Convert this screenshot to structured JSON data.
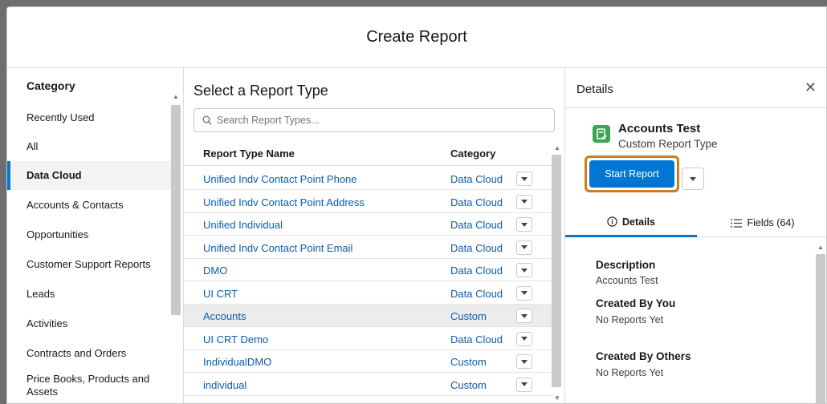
{
  "modal": {
    "title": "Create Report"
  },
  "category": {
    "title": "Category",
    "items": [
      {
        "label": "Recently Used"
      },
      {
        "label": "All"
      },
      {
        "label": "Data Cloud"
      },
      {
        "label": "Accounts & Contacts"
      },
      {
        "label": "Opportunities"
      },
      {
        "label": "Customer Support Reports"
      },
      {
        "label": "Leads"
      },
      {
        "label": "Activities"
      },
      {
        "label": "Contracts and Orders"
      },
      {
        "label": "Price Books, Products and Assets"
      }
    ],
    "selected": "Data Cloud"
  },
  "report_types": {
    "title": "Select a Report Type",
    "search_placeholder": "Search Report Types...",
    "columns": {
      "name": "Report Type Name",
      "category": "Category"
    },
    "rows": [
      {
        "name": "Unified Indv Contact Point Phone",
        "category": "Data Cloud"
      },
      {
        "name": "Unified Indv Contact Point Address",
        "category": "Data Cloud"
      },
      {
        "name": "Unified Individual",
        "category": "Data Cloud"
      },
      {
        "name": "Unified Indv Contact Point Email",
        "category": "Data Cloud"
      },
      {
        "name": "DMO",
        "category": "Data Cloud"
      },
      {
        "name": "UI CRT",
        "category": "Data Cloud"
      },
      {
        "name": "Accounts",
        "category": "Custom"
      },
      {
        "name": "UI CRT Demo",
        "category": "Data Cloud"
      },
      {
        "name": "IndividualDMO",
        "category": "Custom"
      },
      {
        "name": "individual",
        "category": "Custom"
      }
    ],
    "selected_row": "Accounts"
  },
  "details": {
    "title": "Details",
    "report_name": "Accounts Test",
    "report_subtitle": "Custom Report Type",
    "start_button": "Start Report",
    "tabs": {
      "details": "Details",
      "fields": "Fields (64)"
    },
    "description_label": "Description",
    "description_value": "Accounts Test",
    "created_by_you_label": "Created By You",
    "created_by_you_value": "No Reports Yet",
    "created_by_others_label": "Created By Others",
    "created_by_others_value": "No Reports Yet"
  },
  "colors": {
    "accent": "#0176d3",
    "link": "#0b5cab",
    "highlight": "#d07a1a",
    "icon_green": "#3ba755"
  }
}
